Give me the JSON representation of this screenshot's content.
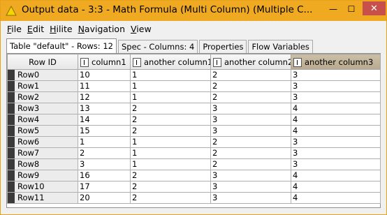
{
  "window": {
    "title": "Output data - 3:3 - Math Formula (Multi Column) (Multiple C...",
    "minimize": "—",
    "maximize": "☐",
    "close": "✕",
    "accent": "#f0aa22"
  },
  "menu": {
    "items": [
      {
        "u": "F",
        "rest": "ile"
      },
      {
        "u": "E",
        "rest": "dit"
      },
      {
        "u": "H",
        "rest": "ilite"
      },
      {
        "u": "N",
        "rest": "avigation"
      },
      {
        "u": "V",
        "rest": "iew"
      }
    ]
  },
  "tabs": [
    "Table \"default\" - Rows: 12",
    "Spec - Columns: 4",
    "Properties",
    "Flow Variables"
  ],
  "table": {
    "headers": [
      "Row ID",
      "column1",
      "another column1",
      "another column2",
      "another column3"
    ],
    "rows": [
      [
        "Row0",
        "10",
        "1",
        "2",
        "3"
      ],
      [
        "Row1",
        "11",
        "1",
        "2",
        "3"
      ],
      [
        "Row2",
        "12",
        "1",
        "2",
        "3"
      ],
      [
        "Row3",
        "13",
        "2",
        "3",
        "4"
      ],
      [
        "Row4",
        "14",
        "2",
        "3",
        "4"
      ],
      [
        "Row5",
        "15",
        "2",
        "3",
        "4"
      ],
      [
        "Row6",
        "1",
        "1",
        "2",
        "3"
      ],
      [
        "Row7",
        "2",
        "1",
        "2",
        "3"
      ],
      [
        "Row8",
        "3",
        "1",
        "2",
        "3"
      ],
      [
        "Row9",
        "16",
        "2",
        "3",
        "4"
      ],
      [
        "Row10",
        "17",
        "2",
        "3",
        "4"
      ],
      [
        "Row11",
        "20",
        "2",
        "3",
        "4"
      ]
    ]
  }
}
